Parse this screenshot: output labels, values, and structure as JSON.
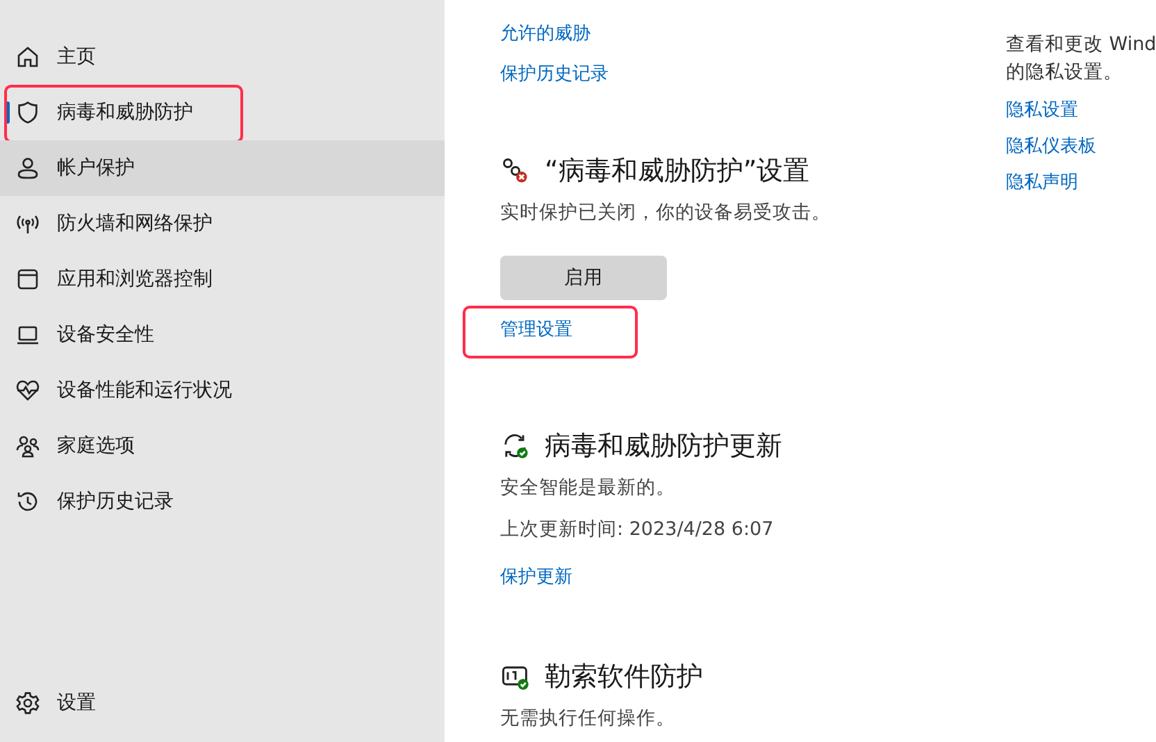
{
  "sidebar": {
    "items": [
      {
        "label": "主页",
        "selected": false,
        "hovered": false,
        "annotated": false
      },
      {
        "label": "病毒和威胁防护",
        "selected": true,
        "hovered": false,
        "annotated": true
      },
      {
        "label": "帐户保护",
        "selected": false,
        "hovered": true,
        "annotated": false
      },
      {
        "label": "防火墙和网络保护",
        "selected": false,
        "hovered": false,
        "annotated": false
      },
      {
        "label": "应用和浏览器控制",
        "selected": false,
        "hovered": false,
        "annotated": false
      },
      {
        "label": "设备安全性",
        "selected": false,
        "hovered": false,
        "annotated": false
      },
      {
        "label": "设备性能和运行状况",
        "selected": false,
        "hovered": false,
        "annotated": false
      },
      {
        "label": "家庭选项",
        "selected": false,
        "hovered": false,
        "annotated": false
      },
      {
        "label": "保护历史记录",
        "selected": false,
        "hovered": false,
        "annotated": false
      }
    ],
    "settings": {
      "label": "设置"
    }
  },
  "main": {
    "top_links": [
      "允许的威胁",
      "保护历史记录"
    ],
    "sections": [
      {
        "title": "“病毒和威胁防护”设置",
        "lines": [
          "实时保护已关闭，你的设备易受攻击。"
        ],
        "button": "启用",
        "links": [
          {
            "label": "管理设置",
            "annotated": true
          }
        ]
      },
      {
        "title": "病毒和威胁防护更新",
        "lines": [
          "安全智能是最新的。",
          "上次更新时间: 2023/4/28 6:07"
        ],
        "links": [
          {
            "label": "保护更新",
            "annotated": false
          }
        ]
      },
      {
        "title": "勒索软件防护",
        "lines": [
          "无需执行任何操作。"
        ]
      }
    ]
  },
  "privacy": {
    "lines": [
      "查看和更改 Wind",
      "的隐私设置。"
    ],
    "links": [
      "隐私设置",
      "隐私仪表板",
      "隐私声明"
    ]
  }
}
